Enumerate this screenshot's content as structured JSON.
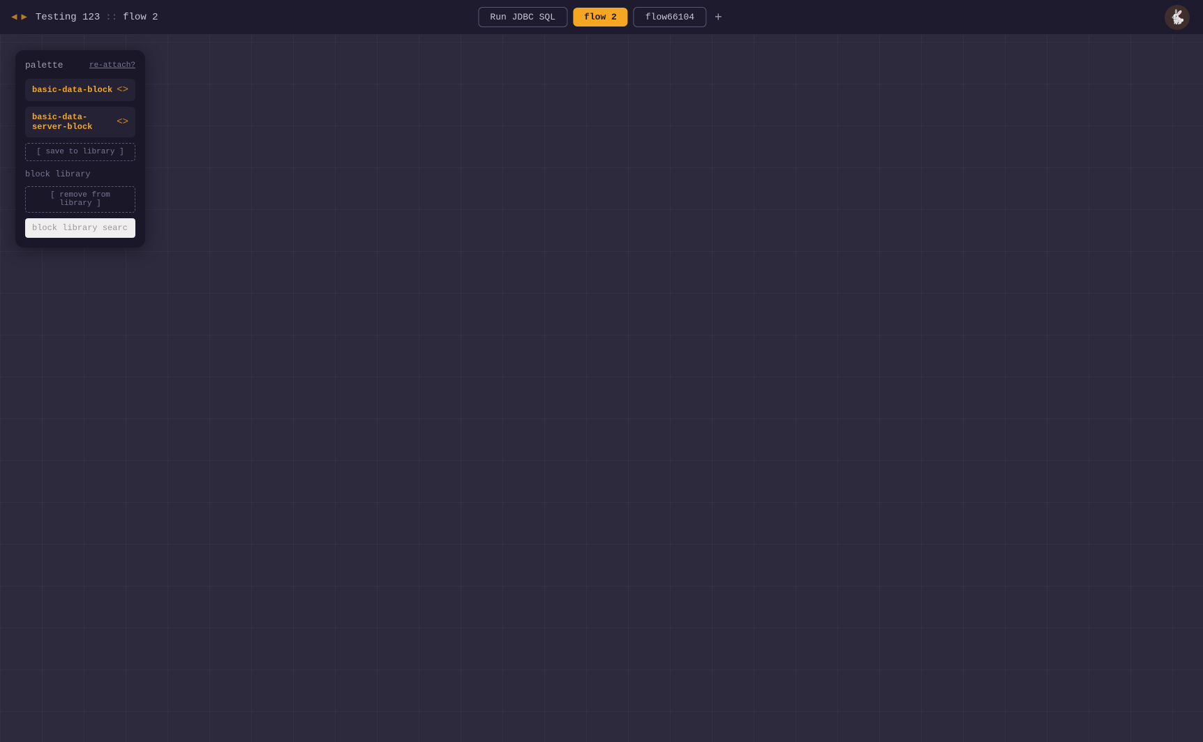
{
  "topbar": {
    "nav_back_icon": "◀",
    "nav_forward_icon": "▶",
    "breadcrumb": {
      "project": "Testing 123",
      "separator": "::",
      "flow": "flow 2"
    },
    "run_button_label": "Run JDBC SQL",
    "tabs": [
      {
        "label": "flow 2",
        "active": true
      },
      {
        "label": "flow66104",
        "active": false
      }
    ],
    "add_tab_icon": "+",
    "logo_alt": "Data Rabbit"
  },
  "palette": {
    "title": "palette",
    "reattach_label": "re-attach?",
    "blocks": [
      {
        "label": "basic-data-block",
        "icon": "<>"
      },
      {
        "label": "basic-data-server-block",
        "icon": "<>"
      }
    ],
    "save_to_library_label": "[ save to library ]",
    "block_library_title": "block library",
    "remove_from_library_label": "[ remove from library ]",
    "search_placeholder": "block library search"
  }
}
